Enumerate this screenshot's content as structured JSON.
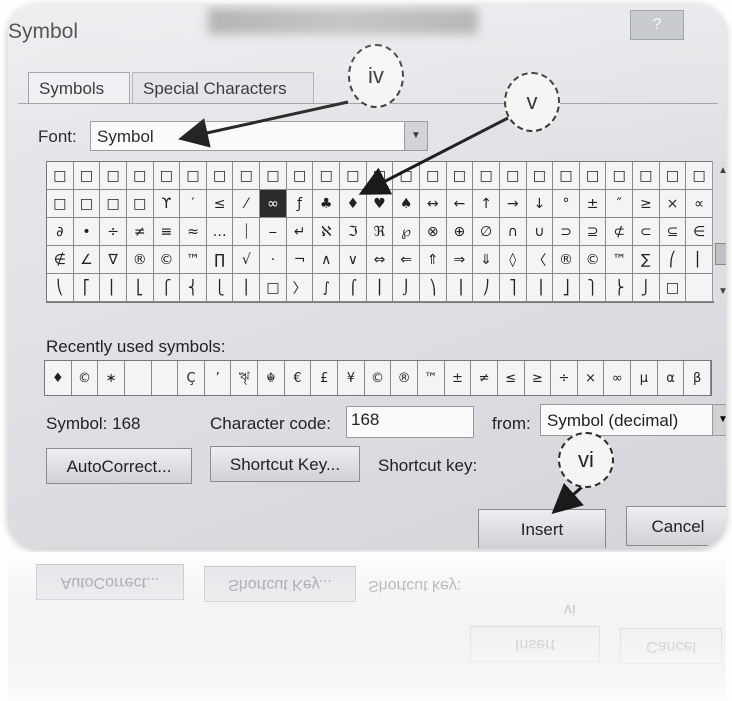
{
  "window": {
    "title": "Symbol",
    "help_button": "?"
  },
  "tabs": [
    {
      "label": "Symbols",
      "active": true
    },
    {
      "label": "Special Characters",
      "active": false
    }
  ],
  "font": {
    "label": "Font:",
    "value": "Symbol"
  },
  "symbol_grid": {
    "selected_index": 33,
    "cells": [
      "□",
      "□",
      "□",
      "□",
      "□",
      "□",
      "□",
      "□",
      "□",
      "□",
      "□",
      "□",
      "□",
      "□",
      "□",
      "□",
      "□",
      "□",
      "□",
      "□",
      "□",
      "□",
      "□",
      "□",
      "□",
      "□",
      "□",
      "□",
      "□",
      "ϒ",
      "′",
      "≤",
      "⁄",
      "∞",
      "ƒ",
      "♣",
      "♦",
      "♥",
      "♠",
      "↔",
      "←",
      "↑",
      "→",
      "↓",
      "°",
      "±",
      "″",
      "≥",
      "×",
      "∝",
      "∂",
      "•",
      "÷",
      "≠",
      "≡",
      "≈",
      "…",
      "⏐",
      "⎯",
      "↵",
      "ℵ",
      "ℑ",
      "ℜ",
      "℘",
      "⊗",
      "⊕",
      "∅",
      "∩",
      "∪",
      "⊃",
      "⊇",
      "⊄",
      "⊂",
      "⊆",
      "∈",
      "∉",
      "∠",
      "∇",
      "®",
      "©",
      "™",
      "∏",
      "√",
      "⋅",
      "¬",
      "∧",
      "∨",
      "⇔",
      "⇐",
      "⇑",
      "⇒",
      "⇓",
      "◊",
      "〈",
      "®",
      "©",
      "™",
      "∑",
      "⎛",
      "⎜",
      "⎝",
      "⎡",
      "⎢",
      "⎣",
      "⎧",
      "⎨",
      "⎩",
      "⎪",
      "□",
      "〉",
      "∫",
      "⌠",
      "⎮",
      "⌡",
      "⎞",
      "⎟",
      "⎠",
      "⎤",
      "⎥",
      "⎦",
      "⎫",
      "⎬",
      "⎭",
      "□",
      ""
    ]
  },
  "recent": {
    "label": "Recently used symbols:",
    "cells": [
      "♦",
      "©",
      "∗",
      "",
      "",
      "Ç",
      "’",
      "ৠ",
      "☬",
      "€",
      "£",
      "¥",
      "©",
      "®",
      "™",
      "±",
      "≠",
      "≤",
      "≥",
      "÷",
      "×",
      "∞",
      "µ",
      "α",
      "β"
    ]
  },
  "info": {
    "symbol": "Symbol: 168",
    "code_label": "Character code:",
    "code_value": "168",
    "from_label": "from:",
    "from_value": "Symbol (decimal)"
  },
  "buttons": {
    "autocorrect": "AutoCorrect...",
    "shortcut_key": "Shortcut Key...",
    "shortcut_label": "Shortcut key:",
    "insert": "Insert",
    "cancel": "Cancel"
  },
  "callouts": {
    "iv": "iv",
    "v": "v",
    "vi": "vi"
  },
  "icons": {
    "dropdown": "chevron-down-icon",
    "scroll_up": "chevron-up-icon",
    "scroll_down": "chevron-down-icon"
  }
}
